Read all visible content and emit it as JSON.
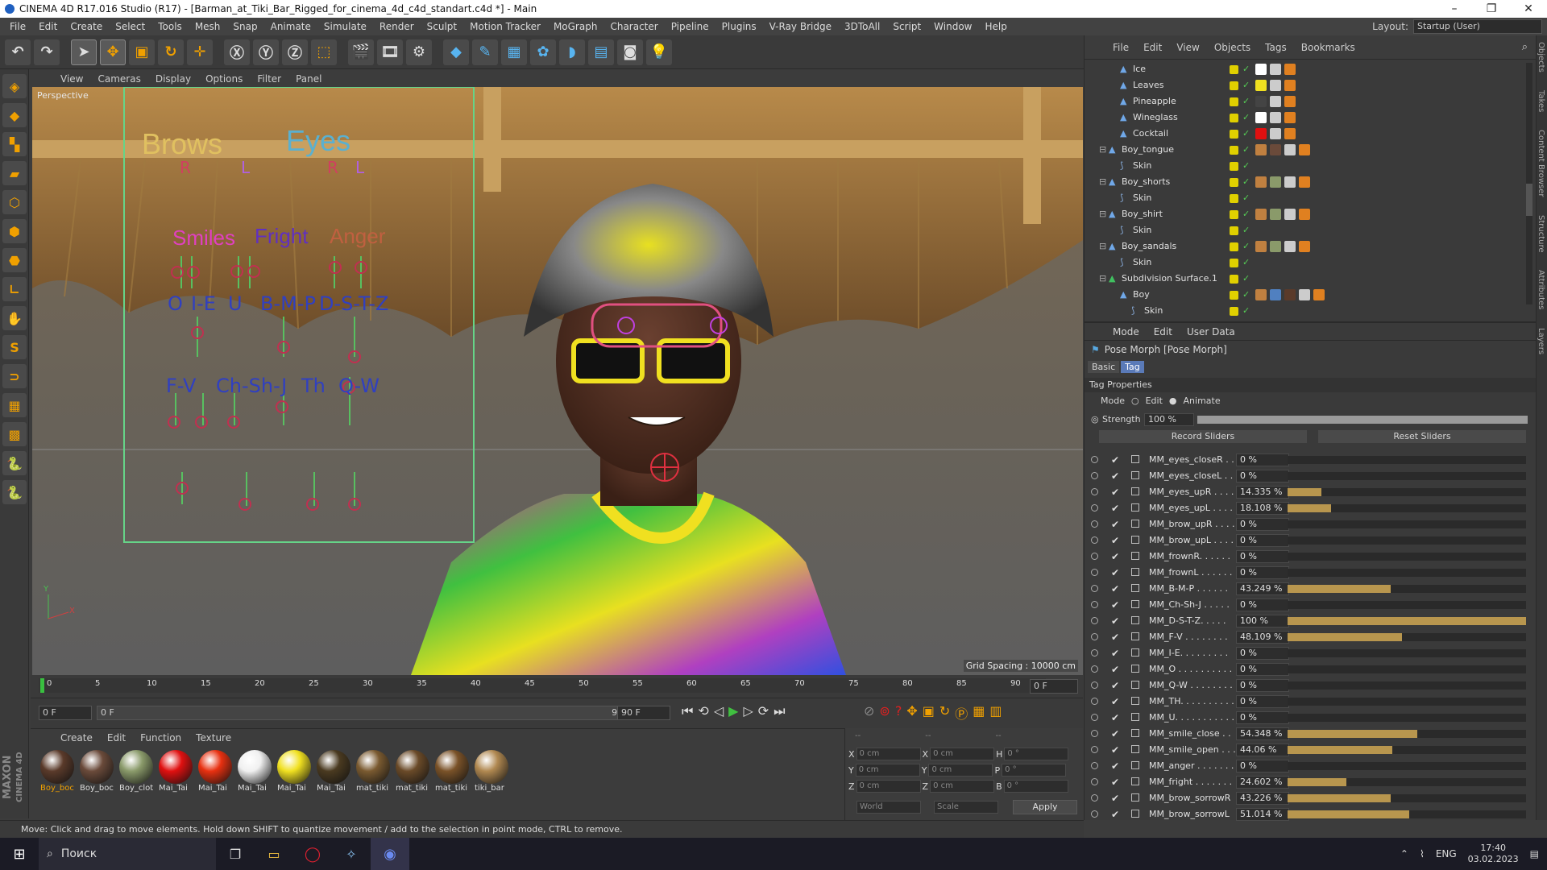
{
  "window": {
    "title": "CINEMA 4D R17.016 Studio (R17) - [Barman_at_Tiki_Bar_Rigged_for_cinema_4d_c4d_standart.c4d *] - Main",
    "controls": [
      "–",
      "❐",
      "✕"
    ]
  },
  "menubar": {
    "items": [
      "File",
      "Edit",
      "Create",
      "Select",
      "Tools",
      "Mesh",
      "Snap",
      "Animate",
      "Simulate",
      "Render",
      "Sculpt",
      "Motion Tracker",
      "MoGraph",
      "Character",
      "Pipeline",
      "Plugins",
      "V-Ray Bridge",
      "3DToAll",
      "Script",
      "Window",
      "Help"
    ],
    "layout_label": "Layout:",
    "layout_value": "Startup (User)"
  },
  "viewport": {
    "menu": [
      "View",
      "Cameras",
      "Display",
      "Options",
      "Filter",
      "Panel"
    ],
    "label": "Perspective",
    "grid_spacing": "Grid Spacing : 10000 cm",
    "overlay": {
      "brows": "Brows",
      "eyes": "Eyes",
      "r1": "R",
      "l1": "L",
      "r2": "R",
      "l2": "L",
      "smiles": "Smiles",
      "fright": "Fright",
      "anger": "Anger",
      "o": "O",
      "ie": "I-E",
      "u": "U",
      "bmp": "B-M-P",
      "dstz": "D-S-T-Z",
      "fv": "F-V",
      "chshj": "Ch-Sh-J",
      "th": "Th",
      "qw": "Q-W"
    },
    "axis_y": "Y",
    "axis_x": "X"
  },
  "timeline": {
    "ticks": [
      "0",
      "5",
      "10",
      "15",
      "20",
      "25",
      "30",
      "35",
      "40",
      "45",
      "50",
      "55",
      "60",
      "65",
      "70",
      "75",
      "80",
      "85",
      "90"
    ],
    "frame_field": "0 F"
  },
  "transport": {
    "start": "0 F",
    "range_start": "0 F",
    "range_end": "90 F",
    "end": "90 F"
  },
  "materials": {
    "menu": [
      "Create",
      "Edit",
      "Function",
      "Texture"
    ],
    "items": [
      {
        "label": "Boy_boc",
        "color": "#5a3a2a"
      },
      {
        "label": "Boy_boc",
        "color": "#6a4a3a"
      },
      {
        "label": "Boy_clot",
        "color": "#8a9a6a"
      },
      {
        "label": "Mai_Tai",
        "color": "#e01010"
      },
      {
        "label": "Mai_Tai",
        "color": "#e83010"
      },
      {
        "label": "Mai_Tai",
        "color": "#f0f0f0"
      },
      {
        "label": "Mai_Tai",
        "color": "#f0e020"
      },
      {
        "label": "Mai_Tai",
        "color": "#4a3a20"
      },
      {
        "label": "mat_tiki",
        "color": "#7a5a30"
      },
      {
        "label": "mat_tiki",
        "color": "#6a4a28"
      },
      {
        "label": "mat_tiki",
        "color": "#7a5228"
      },
      {
        "label": "tiki_bar",
        "color": "#b08850"
      }
    ]
  },
  "coords": {
    "header": [
      "--",
      "--",
      "--"
    ],
    "rows": [
      {
        "a": "X",
        "av": "0 cm",
        "b": "X",
        "bv": "0 cm",
        "c": "H",
        "cv": "0 °"
      },
      {
        "a": "Y",
        "av": "0 cm",
        "b": "Y",
        "bv": "0 cm",
        "c": "P",
        "cv": "0 °"
      },
      {
        "a": "Z",
        "av": "0 cm",
        "b": "Z",
        "bv": "0 cm",
        "c": "B",
        "cv": "0 °"
      }
    ],
    "world": "World",
    "scale": "Scale",
    "apply": "Apply"
  },
  "status": "Move: Click and drag to move elements. Hold down SHIFT to quantize movement / add to the selection in point mode, CTRL to remove.",
  "objects": {
    "menu": [
      "File",
      "Edit",
      "View",
      "Objects",
      "Tags",
      "Bookmarks"
    ],
    "rows": [
      {
        "name": "Ice",
        "indent": 1,
        "tags": [
          "#ffffff",
          "#ccc",
          "#e08020"
        ]
      },
      {
        "name": "Leaves",
        "indent": 1,
        "tags": [
          "#f0e020",
          "#ccc",
          "#e08020"
        ]
      },
      {
        "name": "Pineapple",
        "indent": 1,
        "tags": [
          "#444444",
          "#ccc",
          "#e08020"
        ]
      },
      {
        "name": "Wineglass",
        "indent": 1,
        "tags": [
          "#ffffff",
          "#ccc",
          "#e08020"
        ]
      },
      {
        "name": "Cocktail",
        "indent": 1,
        "tags": [
          "#e01010",
          "#ccc",
          "#e08020"
        ]
      },
      {
        "name": "Boy_tongue",
        "indent": 0,
        "tags": [
          "#c08040",
          "#6a4a3a",
          "#ccc",
          "#e08020"
        ]
      },
      {
        "name": "Skin",
        "indent": 1,
        "tags": []
      },
      {
        "name": "Boy_shorts",
        "indent": 0,
        "tags": [
          "#c08040",
          "#8a9a6a",
          "#ccc",
          "#e08020"
        ]
      },
      {
        "name": "Skin",
        "indent": 1,
        "tags": []
      },
      {
        "name": "Boy_shirt",
        "indent": 0,
        "tags": [
          "#c08040",
          "#8a9a6a",
          "#ccc",
          "#e08020"
        ]
      },
      {
        "name": "Skin",
        "indent": 1,
        "tags": []
      },
      {
        "name": "Boy_sandals",
        "indent": 0,
        "tags": [
          "#c08040",
          "#8a9a6a",
          "#ccc",
          "#e08020"
        ]
      },
      {
        "name": "Skin",
        "indent": 1,
        "tags": []
      },
      {
        "name": "Subdivision Surface.1",
        "indent": 0,
        "tags": []
      },
      {
        "name": "Boy",
        "indent": 1,
        "tags": [
          "#c08040",
          "#5080c0",
          "#5a3a2a",
          "#ccc",
          "#e08020"
        ]
      },
      {
        "name": "Skin",
        "indent": 2,
        "tags": []
      }
    ]
  },
  "attributes": {
    "menu": [
      "Mode",
      "Edit",
      "User Data"
    ],
    "object_title": "Pose Morph [Pose Morph]",
    "tabs": [
      "Basic",
      "Tag"
    ],
    "section": "Tag Properties",
    "mode_label": "Mode",
    "mode_edit": "Edit",
    "mode_animate": "Animate",
    "strength_label": "Strength",
    "strength_value": "100 %",
    "record_sliders": "Record Sliders",
    "reset_sliders": "Reset Sliders",
    "morphs": [
      {
        "name": "MM_eyes_closeR . .",
        "value": "0 %",
        "fraction": 0
      },
      {
        "name": "MM_eyes_closeL . . .",
        "value": "0 %",
        "fraction": 0
      },
      {
        "name": "MM_eyes_upR . . . .",
        "value": "14.335 %",
        "fraction": 0.14335
      },
      {
        "name": "MM_eyes_upL . . . . .",
        "value": "18.108 %",
        "fraction": 0.18108
      },
      {
        "name": "MM_brow_upR . . . .",
        "value": "0 %",
        "fraction": 0
      },
      {
        "name": "MM_brow_upL . . . . .",
        "value": "0 %",
        "fraction": 0
      },
      {
        "name": "MM_frownR. . . . . .",
        "value": "0 %",
        "fraction": 0
      },
      {
        "name": "MM_frownL . . . . . .",
        "value": "0 %",
        "fraction": 0
      },
      {
        "name": "MM_B-M-P . . . . . .",
        "value": "43.249 %",
        "fraction": 0.43249
      },
      {
        "name": "MM_Ch-Sh-J . . . . .",
        "value": "0 %",
        "fraction": 0
      },
      {
        "name": "MM_D-S-T-Z. . . . .",
        "value": "100 %",
        "fraction": 1
      },
      {
        "name": "MM_F-V . . . . . . . .",
        "value": "48.109 %",
        "fraction": 0.48109
      },
      {
        "name": "MM_I-E. . . . . . . . .",
        "value": "0 %",
        "fraction": 0
      },
      {
        "name": "MM_O . . . . . . . . . .",
        "value": "0 %",
        "fraction": 0
      },
      {
        "name": "MM_Q-W . . . . . . . .",
        "value": "0 %",
        "fraction": 0
      },
      {
        "name": "MM_TH. . . . . . . . . .",
        "value": "0 %",
        "fraction": 0
      },
      {
        "name": "MM_U. . . . . . . . . . .",
        "value": "0 %",
        "fraction": 0
      },
      {
        "name": "MM_smile_close . .",
        "value": "54.348 %",
        "fraction": 0.54348
      },
      {
        "name": "MM_smile_open . . .",
        "value": "44.06 %",
        "fraction": 0.4406
      },
      {
        "name": "MM_anger . . . . . . .",
        "value": "0 %",
        "fraction": 0
      },
      {
        "name": "MM_fright . . . . . . .",
        "value": "24.602 %",
        "fraction": 0.24602
      },
      {
        "name": "MM_brow_sorrowR",
        "value": "43.226 %",
        "fraction": 0.43226
      },
      {
        "name": "MM_brow_sorrowL",
        "value": "51.014 %",
        "fraction": 0.51014
      }
    ]
  },
  "side_tabs": [
    "Objects",
    "Takes",
    "Content Browser",
    "Structure",
    "Attributes",
    "Layers"
  ],
  "taskbar": {
    "search": "Поиск",
    "lang": "ENG",
    "time": "17:40",
    "date": "03.02.2023"
  },
  "brand": {
    "maxon": "MAXON",
    "c4d": "CINEMA 4D"
  }
}
